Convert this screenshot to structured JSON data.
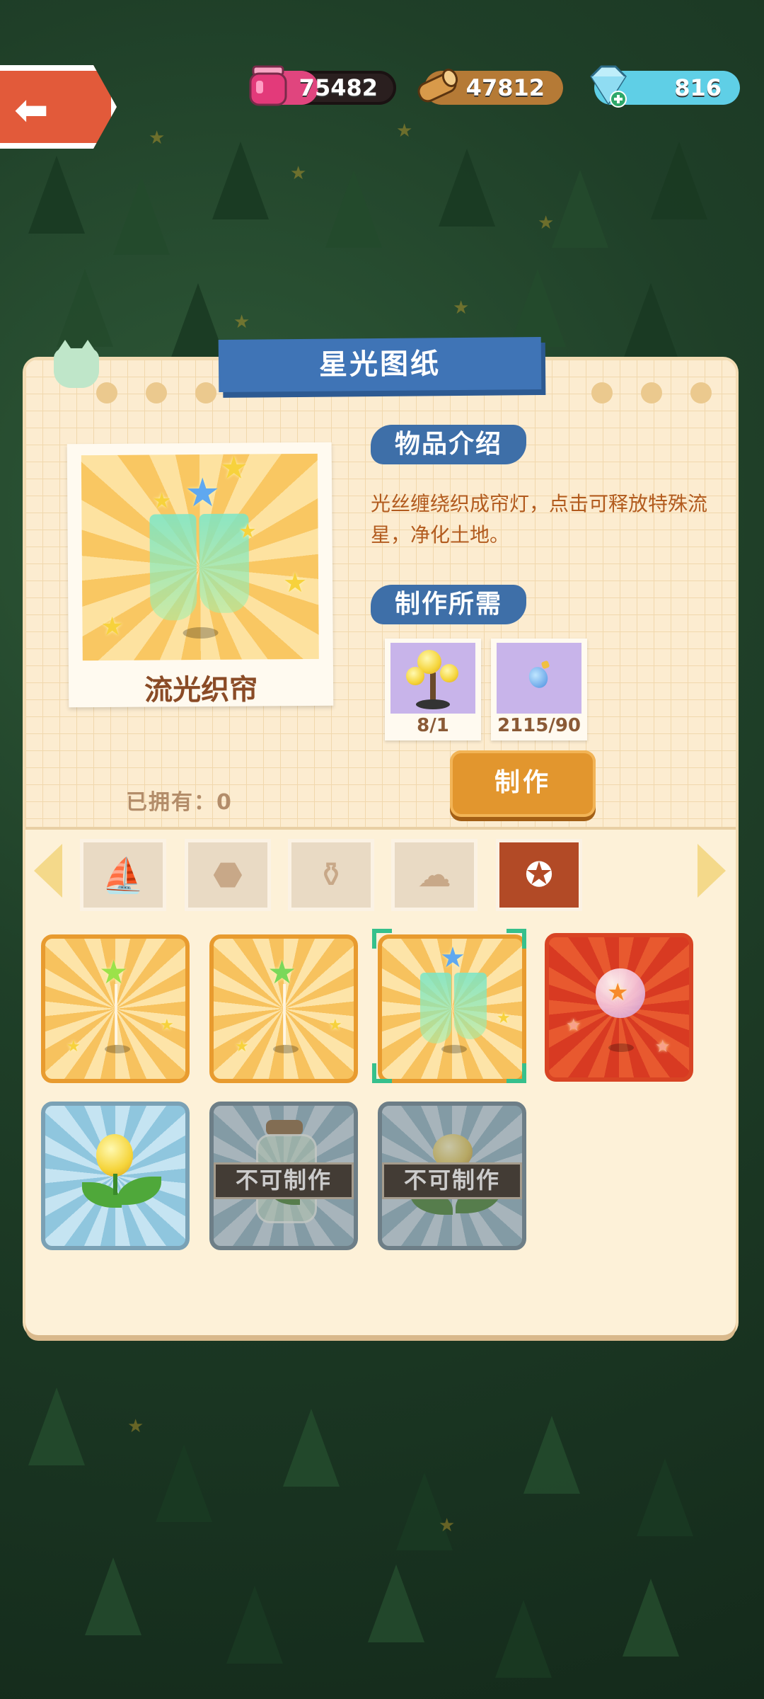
{
  "resources": {
    "jam": "75482",
    "wood": "47812",
    "gems": "816"
  },
  "panel": {
    "title": "星光图纸",
    "item_name": "流光织帘",
    "intro_label": "物品介绍",
    "description": "光丝缠绕织成帘灯，点击可释放特殊流星，净化土地。",
    "requirements_label": "制作所需",
    "requirements": [
      {
        "icon": "golden-tree-icon",
        "value": "8/1"
      },
      {
        "icon": "blue-potion-icon",
        "value": "2115/90"
      }
    ],
    "owned_label": "已拥有：0",
    "craft_label": "制作"
  },
  "tabs": [
    {
      "icon": "boat-icon",
      "active": false
    },
    {
      "icon": "rock-icon",
      "active": false
    },
    {
      "icon": "watering-can-icon",
      "active": false
    },
    {
      "icon": "cloud-icon",
      "active": false
    },
    {
      "icon": "star-icon",
      "active": true
    }
  ],
  "grid": [
    {
      "icon": "green-star-lamp-icon",
      "style": "yellow",
      "locked": false
    },
    {
      "icon": "green-star-lamp-icon",
      "style": "yellow",
      "locked": false
    },
    {
      "icon": "star-curtain-icon",
      "style": "yellow",
      "locked": false,
      "selected": true
    },
    {
      "icon": "star-orb-icon",
      "style": "red",
      "locked": false
    },
    {
      "icon": "glowing-sprout-icon",
      "style": "blue",
      "locked": false
    },
    {
      "icon": "sprout-jar-icon",
      "style": "blue",
      "locked": true,
      "locked_label": "不可制作"
    },
    {
      "icon": "flower-sprout-icon",
      "style": "blue",
      "locked": true,
      "locked_label": "不可制作"
    }
  ],
  "colors": {
    "title_banner": "#3f74b6",
    "craft_button": "#e2962e",
    "selection": "#36c08c"
  }
}
